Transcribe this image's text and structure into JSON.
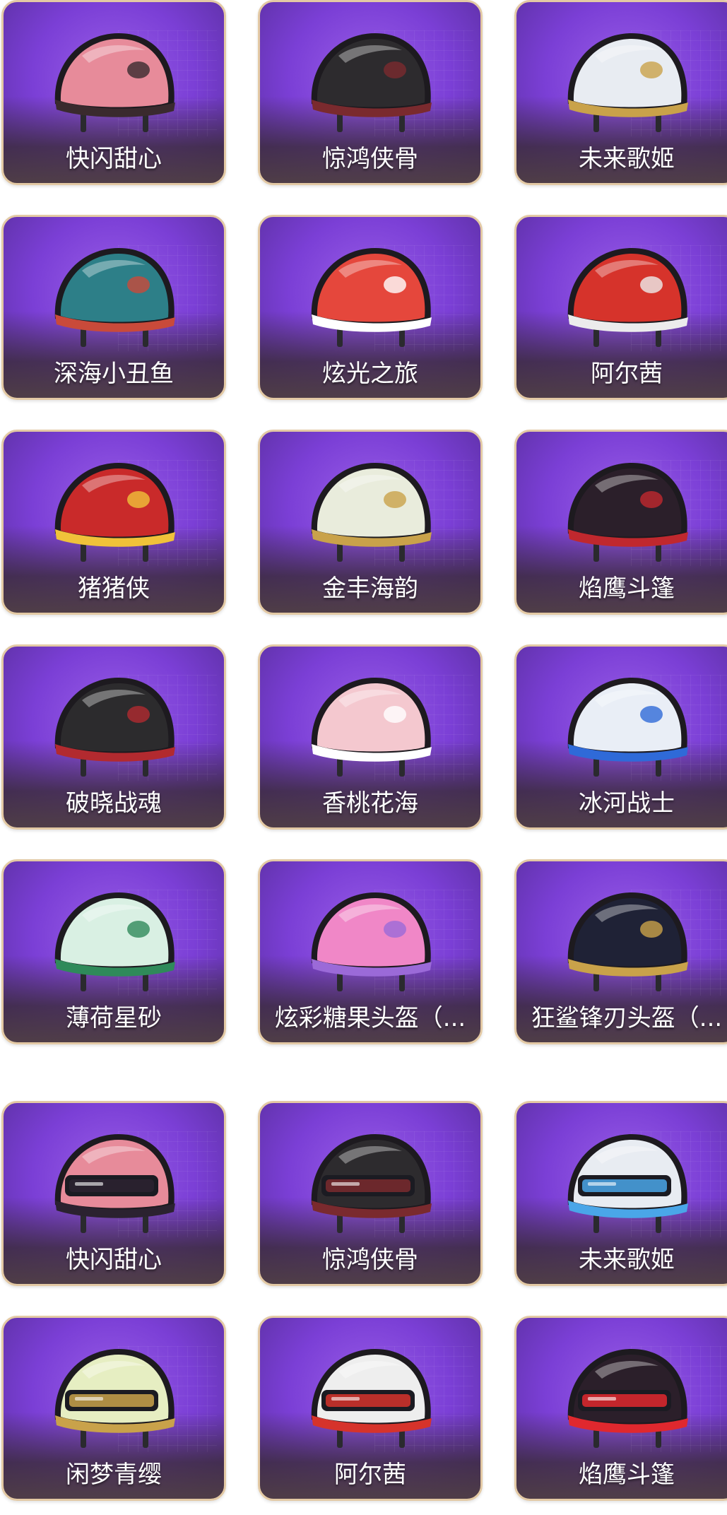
{
  "helmets_lv2": [
    {
      "label": "快闪甜心",
      "icon": "pink-helmet-icon",
      "color": "#e78b9a",
      "trim": "#3a2a2e"
    },
    {
      "label": "惊鸿侠骨",
      "icon": "black-winged-helmet-icon",
      "color": "#2d2b2e",
      "trim": "#7a2a2e"
    },
    {
      "label": "未来歌姬",
      "icon": "white-idol-helmet-icon",
      "color": "#e8ecf2",
      "trim": "#c9a24a"
    },
    {
      "label": "深海小丑鱼",
      "icon": "teal-clownfish-helmet-icon",
      "color": "#2d7f88",
      "trim": "#c94a3a"
    },
    {
      "label": "炫光之旅",
      "icon": "red-cross-helmet-icon",
      "color": "#e5473c",
      "trim": "#ffffff"
    },
    {
      "label": "阿尔茜",
      "icon": "red-white-helmet-icon",
      "color": "#d6332b",
      "trim": "#ececec"
    },
    {
      "label": "猪猪侠",
      "icon": "pig-hero-helmet-icon",
      "color": "#c92a2a",
      "trim": "#f0c23a"
    },
    {
      "label": "金丰海韵",
      "icon": "jade-wave-helmet-icon",
      "color": "#e9ecdc",
      "trim": "#c9a24a"
    },
    {
      "label": "焰鹰斗篷",
      "icon": "dark-red-ornate-helmet-icon",
      "color": "#2b1f2a",
      "trim": "#c0282e"
    },
    {
      "label": "破晓战魂",
      "icon": "spiked-black-helmet-icon",
      "color": "#2c2b2d",
      "trim": "#b22a2f"
    },
    {
      "label": "香桃花海",
      "icon": "peach-bow-helmet-icon",
      "color": "#f4c8cf",
      "trim": "#ffffff"
    },
    {
      "label": "冰河战士",
      "icon": "blue-white-helmet-icon",
      "color": "#e9eef6",
      "trim": "#2f6ad8"
    },
    {
      "label": "薄荷星砂",
      "icon": "mint-helmet-icon",
      "color": "#d9f0e3",
      "trim": "#2f8a5a"
    },
    {
      "label": "炫彩糖果头盔（...",
      "icon": "candy-dessert-helmet-icon",
      "color": "#f087c7",
      "trim": "#9b6ad8"
    },
    {
      "label": "狂鲨锋刃头盔（...",
      "icon": "shark-helmet-icon",
      "color": "#1f2236",
      "trim": "#c9a24a"
    }
  ],
  "helmets_lv3": [
    {
      "label": "快闪甜心",
      "icon": "pink-visor-helmet-icon",
      "color": "#e78b9a",
      "trim": "#2b2230"
    },
    {
      "label": "惊鸿侠骨",
      "icon": "black-visor-helmet-icon",
      "color": "#2d2b2e",
      "trim": "#7a2a2e"
    },
    {
      "label": "未来歌姬",
      "icon": "white-crystal-visor-helmet-icon",
      "color": "#e8ecf2",
      "trim": "#4aa6e8"
    },
    {
      "label": "闲梦青缨",
      "icon": "pale-green-visor-helmet-icon",
      "color": "#e6eec2",
      "trim": "#c9a24a"
    },
    {
      "label": "阿尔茜",
      "icon": "white-red-visor-helmet-icon",
      "color": "#eeeeee",
      "trim": "#d6332b"
    },
    {
      "label": "焰鹰斗篷",
      "icon": "dark-red-visor-helmet-icon",
      "color": "#2b1f2a",
      "trim": "#e0282e"
    }
  ]
}
